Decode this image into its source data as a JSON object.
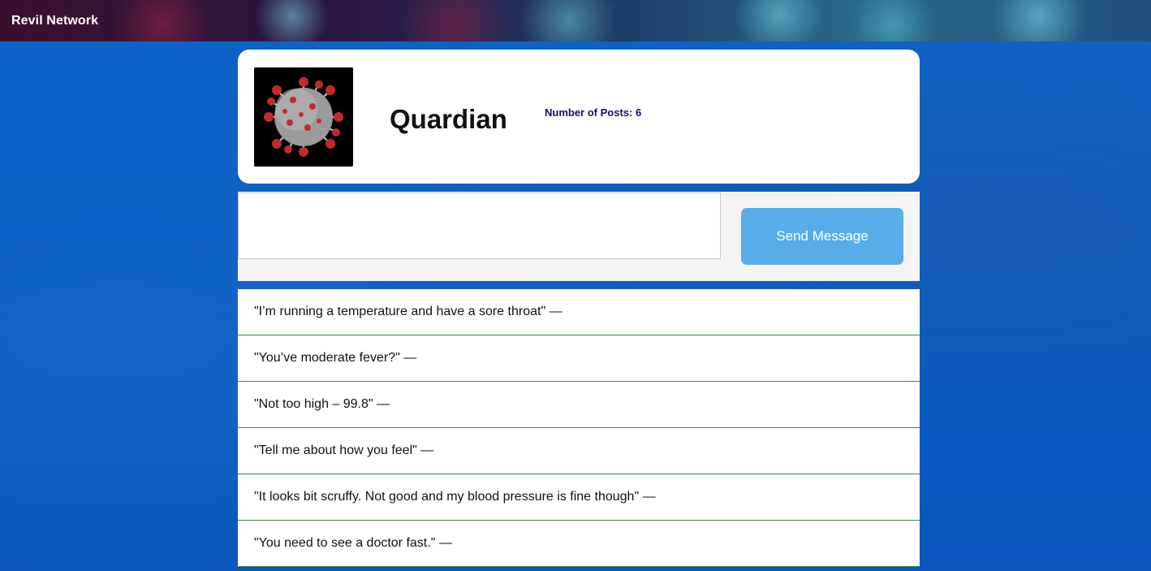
{
  "header": {
    "brand": "Revil Network"
  },
  "profile": {
    "avatar_icon": "coronavirus-image",
    "name": "Quardian",
    "posts_label": "Number of Posts: 6"
  },
  "compose": {
    "input_value": "",
    "send_label": "Send Message"
  },
  "messages": [
    "\"I’m running a temperature and have a sore throat\" —",
    "\"You’ve moderate fever?\" —",
    "\"Not too high – 99.8\" —",
    "\"Tell me about how you feel\" —",
    "\"It looks bit scruffy. Not good and my blood pressure is fine though\" —",
    "\"You need to see a doctor fast.\" —"
  ],
  "colors": {
    "page_background": "#0b5cc2",
    "send_button": "#59ade8",
    "row_divider": "#2e8b3c",
    "posts_text": "#12106a"
  }
}
